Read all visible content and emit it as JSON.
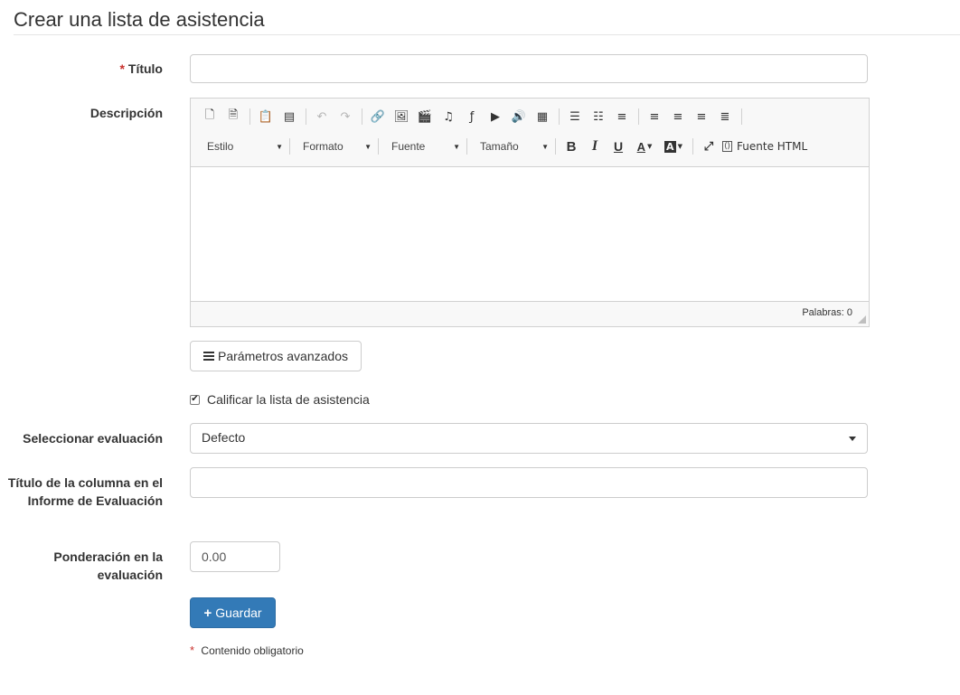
{
  "page": {
    "title": "Crear una lista de asistencia"
  },
  "form": {
    "title_label": "Título",
    "required_marker": "*",
    "title_value": "",
    "description_label": "Descripción",
    "advanced_button": "Parámetros avanzados",
    "qualify_checkbox": {
      "label": "Calificar la lista de asistencia",
      "checked": true,
      "mark": "✔"
    },
    "evaluation_label": "Seleccionar evaluación",
    "evaluation_value": "Defecto",
    "column_title_label": "Título de la columna en el Informe de Evaluación",
    "column_title_value": "",
    "weight_label": "Ponderación en la evaluación",
    "weight_value": "0.00",
    "save_button": "Guardar",
    "required_note": "Contenido obligatorio"
  },
  "editor": {
    "toolbar_row1_icons": [
      {
        "name": "new-page-icon",
        "glyph": "🗋"
      },
      {
        "name": "preview-icon",
        "glyph": "🗎"
      },
      {
        "name": "paste-word-icon",
        "glyph": "📋"
      },
      {
        "name": "paste-html-icon",
        "glyph": "▤"
      },
      {
        "name": "undo-icon",
        "glyph": "↶"
      },
      {
        "name": "redo-icon",
        "glyph": "↷"
      },
      {
        "name": "link-icon",
        "glyph": "🔗"
      },
      {
        "name": "image-icon",
        "glyph": "🖼"
      },
      {
        "name": "video-icon",
        "glyph": "🎬"
      },
      {
        "name": "audio-clip-icon",
        "glyph": "♫"
      },
      {
        "name": "flash-icon",
        "glyph": "ƒ"
      },
      {
        "name": "youtube-icon",
        "glyph": "▶"
      },
      {
        "name": "sound-icon",
        "glyph": "🔊"
      },
      {
        "name": "table-icon",
        "glyph": "▦"
      },
      {
        "name": "bulleted-list-icon",
        "glyph": "☰"
      },
      {
        "name": "numbered-list-icon",
        "glyph": "☷"
      },
      {
        "name": "horizontal-rule-icon",
        "glyph": "≡"
      },
      {
        "name": "align-left-icon",
        "glyph": "≡"
      },
      {
        "name": "align-center-icon",
        "glyph": "≡"
      },
      {
        "name": "align-right-icon",
        "glyph": "≡"
      },
      {
        "name": "justify-icon",
        "glyph": "≣"
      }
    ],
    "combos": {
      "style": "Estilo",
      "format": "Formato",
      "font": "Fuente",
      "size": "Tamaño"
    },
    "format_buttons": {
      "bold": "B",
      "italic": "I",
      "underline": "U",
      "text_color": "A",
      "bg_color": "A"
    },
    "maximize_glyph": "⤢",
    "source_glyph": "⟨⟩",
    "source_label": "Fuente HTML",
    "word_count": "Palabras: 0"
  }
}
